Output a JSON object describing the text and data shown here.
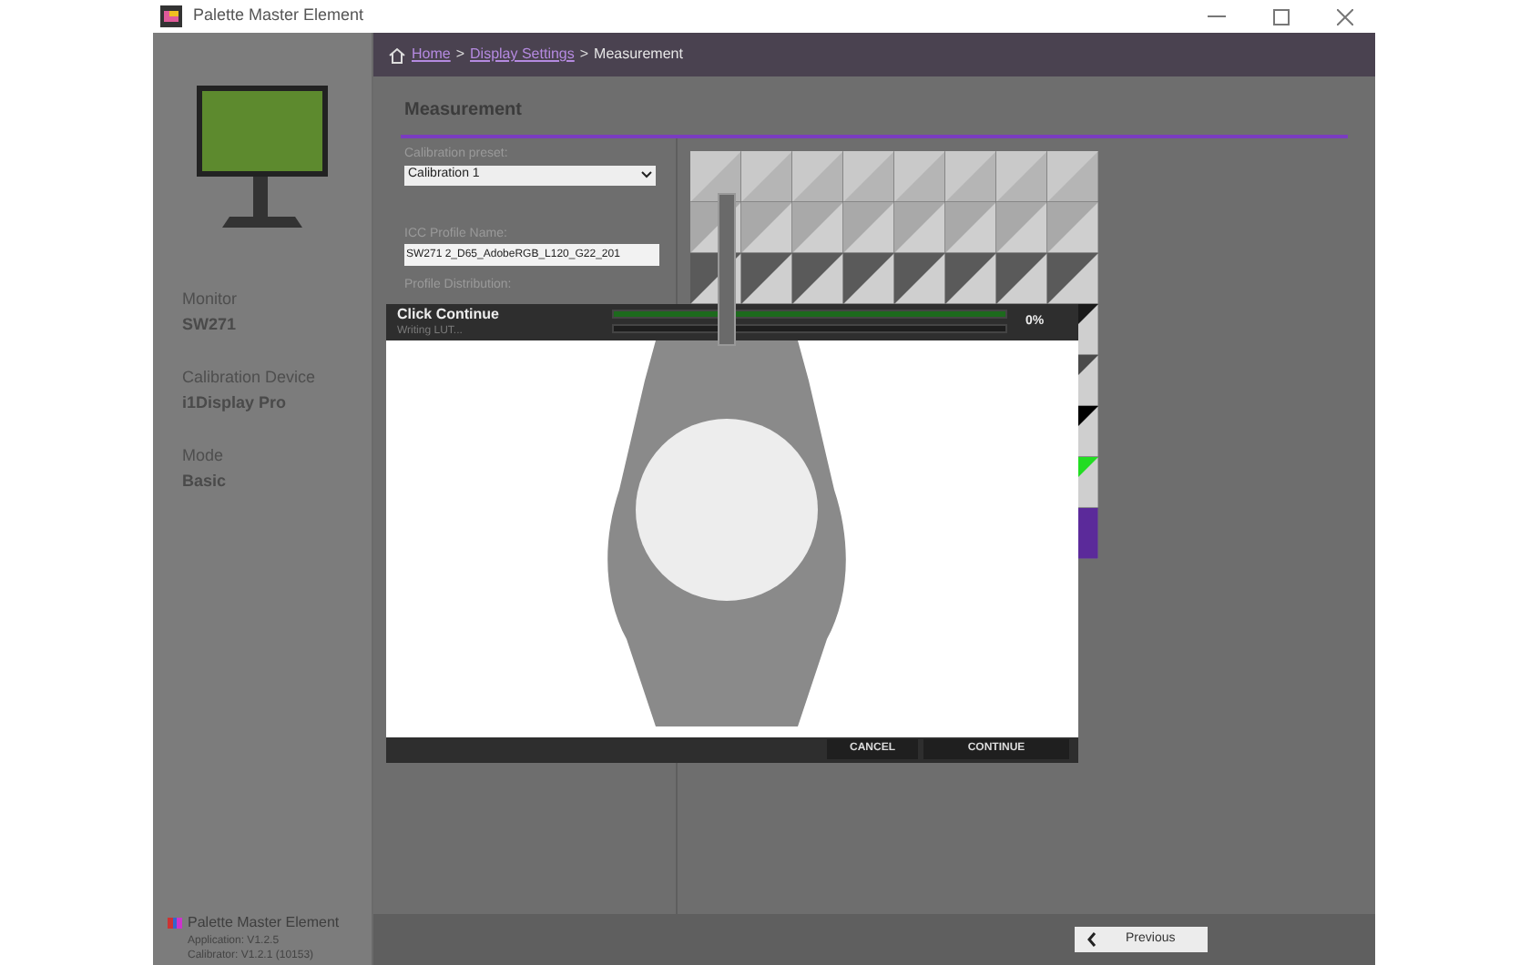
{
  "window": {
    "title": "Palette Master Element"
  },
  "sidebar": {
    "fields": [
      {
        "label": "Monitor",
        "value": "SW271"
      },
      {
        "label": "Calibration Device",
        "value": "i1Display Pro"
      },
      {
        "label": "Mode",
        "value": "Basic"
      }
    ],
    "footer": {
      "app_name": "Palette Master Element",
      "lines": [
        "Application: V1.2.5",
        "Calibrator: V1.2.1 (10153)"
      ]
    }
  },
  "breadcrumb": {
    "links": [
      "Home",
      "Display Settings"
    ],
    "current": "Measurement",
    "separator": ">"
  },
  "section_title": "Measurement",
  "form": {
    "preset_label": "Calibration preset:",
    "preset_value": "Calibration 1",
    "icc_label": "ICC Profile Name:",
    "icc_value": "SW271 2_D65_AdobeRGB_L120_G22_201",
    "distribution_label": "Profile Distribution:"
  },
  "dialog": {
    "title": "Click Continue",
    "status": "Writing LUT...",
    "progress": {
      "level": 1
    },
    "percent": "0%",
    "buttons": [
      "CANCEL",
      "CONTINUE"
    ]
  },
  "footer_buttons": [
    {
      "label": "Previous"
    }
  ]
}
